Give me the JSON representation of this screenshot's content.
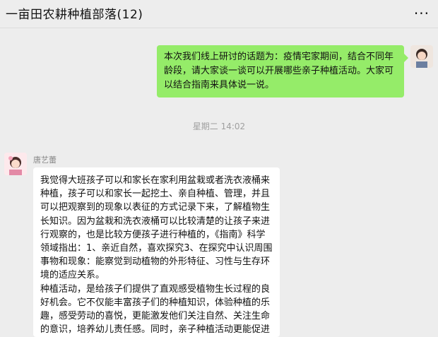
{
  "header": {
    "title": "一亩田农耕种植部落(12)",
    "more_label": "···"
  },
  "messages": {
    "outgoing": {
      "text": "本次我们线上研讨的话题为：疫情宅家期间，结合不同年龄段，请大家谈一谈可以开展哪些亲子种植活动。大家可以结合指南来具体说一说。"
    },
    "timestamp": "星期二 14:02",
    "incoming": {
      "sender": "唐艺蕾",
      "paragraph1": "我觉得大班孩子可以和家长在家利用盆栽或者洗衣液桶来种植，孩子可以和家长一起挖土、亲自种植、管理，并且可以把观察到的现象以表征的方式记录下来，了解植物生长知识。因为盆栽和洗衣液桶可以比较清楚的让孩子来进行观察的，也是比较方便孩子进行种植的，《指南》科学领域指出：1、亲近自然，喜欢探究3、在探究中认识周围事物和现象：能察觉到动植物的外形特征、习性与生存环境的适应关系。",
      "paragraph2": "种植活动，是给孩子们提供了直观感受植物生长过程的良好机会。它不仅能丰富孩子们的种植知识，体验种植的乐趣，感受劳动的喜悦，更能激发他们关注自然、关注生命的意识，培养幼儿责任感。同时，亲子种植活动更能促进"
    }
  }
}
